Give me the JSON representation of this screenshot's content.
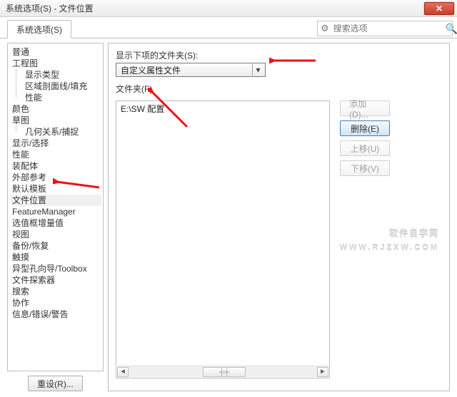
{
  "title": "系统选项(S) - 文件位置",
  "close_glyph": "✕",
  "tab_label": "系统选项(S)",
  "search": {
    "placeholder": "搜索选项"
  },
  "tree": {
    "items": [
      "普通",
      "工程图",
      "颜色",
      "草图",
      "显示/选择",
      "性能",
      "装配体",
      "外部参考",
      "默认模板",
      "文件位置",
      "FeatureManager",
      "选值框增量值",
      "视图",
      "备份/恢复",
      "触摸",
      "异型孔向导/Toolbox",
      "文件探索器",
      "搜索",
      "协作",
      "信息/错误/警告"
    ],
    "drawing_children": [
      "显示类型",
      "区域剖面线/填充",
      "性能"
    ],
    "sketch_children": [
      "几何关系/捕捉"
    ],
    "selected": "文件位置"
  },
  "reset_label": "重设(R)...",
  "right": {
    "show_folders_label": "显示下项的文件夹(S):",
    "combo_value": "自定义属性文件",
    "folders_label": "文件夹(F)",
    "list_items": [
      "E:\\SW 配置"
    ],
    "buttons": {
      "add": "添加(D)...",
      "delete": "删除(E)",
      "up": "上移(U)",
      "down": "下移(V)"
    }
  },
  "watermark": {
    "line1": "软件自学网",
    "line2": "WWW.RJZXW.COM"
  }
}
